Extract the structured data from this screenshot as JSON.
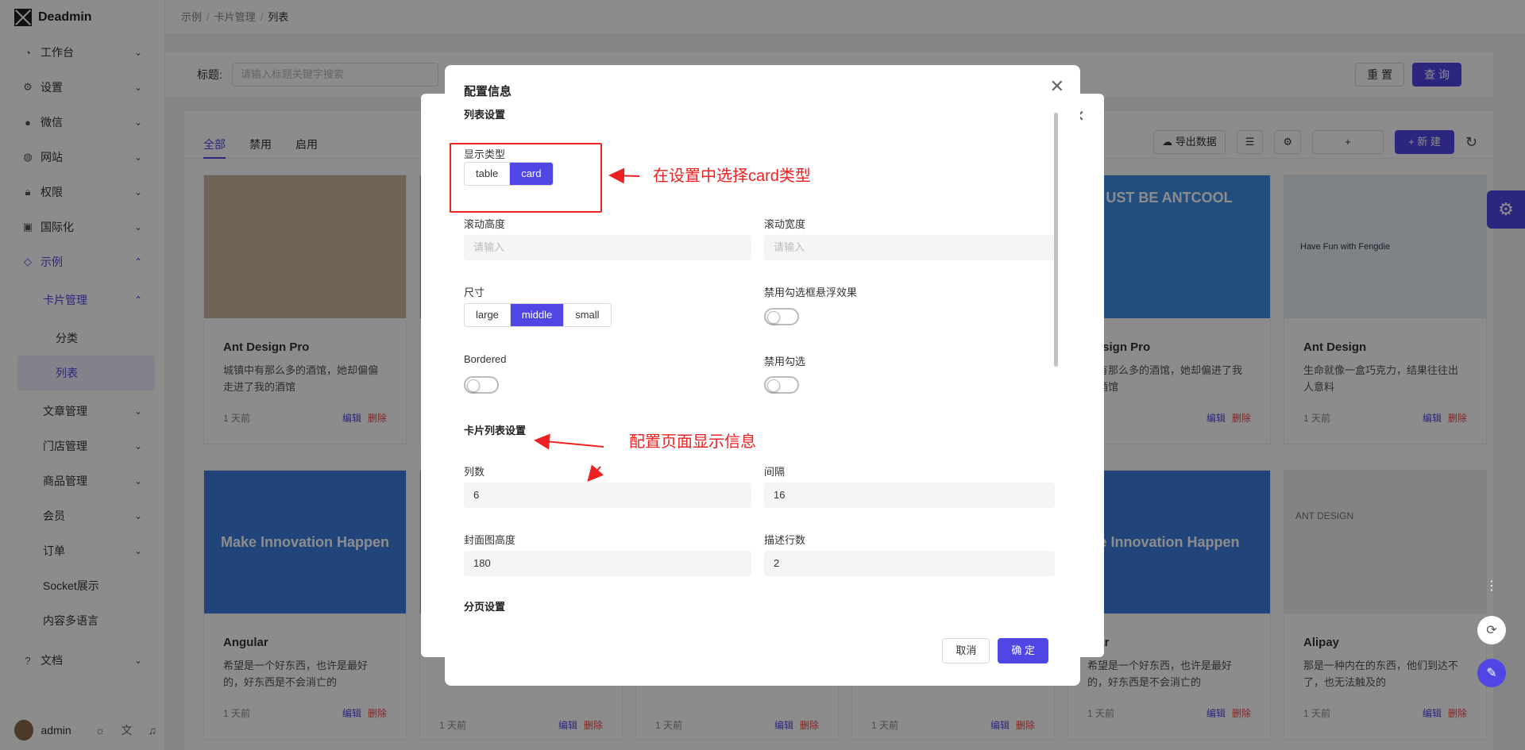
{
  "app": {
    "name": "Deadmin"
  },
  "sidebar": {
    "items": [
      {
        "label": "工作台",
        "icon": "dashboard-icon"
      },
      {
        "label": "设置",
        "icon": "gear-icon"
      },
      {
        "label": "微信",
        "icon": "wechat-icon"
      },
      {
        "label": "网站",
        "icon": "globe-icon"
      },
      {
        "label": "权限",
        "icon": "lock-icon"
      },
      {
        "label": "国际化",
        "icon": "translate-icon"
      },
      {
        "label": "示例",
        "icon": "tag-icon"
      },
      {
        "label": "卡片管理"
      },
      {
        "label": "分类"
      },
      {
        "label": "列表"
      },
      {
        "label": "文章管理"
      },
      {
        "label": "门店管理"
      },
      {
        "label": "商品管理"
      },
      {
        "label": "会员"
      },
      {
        "label": "订单"
      },
      {
        "label": "Socket展示"
      },
      {
        "label": "内容多语言"
      },
      {
        "label": "文档",
        "icon": "question-icon"
      }
    ],
    "user": "admin"
  },
  "breadcrumb": [
    "示例",
    "卡片管理",
    "列表"
  ],
  "search": {
    "label": "标题:",
    "placeholder": "请输入标题关键字搜索",
    "reset": "重 置",
    "query": "查 询"
  },
  "tabs": [
    "全部",
    "禁用",
    "启用"
  ],
  "toolbar": {
    "export": "导出数据",
    "plus": "+",
    "new": "+ 新 建"
  },
  "cards": [
    {
      "title": "Ant Design Pro",
      "desc": "城镇中有那么多的酒馆，她却偏偏走进了我的酒馆",
      "time": "1 天前",
      "cover": ""
    },
    {
      "title": "",
      "desc": "",
      "time": "",
      "cover": ""
    },
    {
      "title": "",
      "desc": "",
      "time": "",
      "cover": ""
    },
    {
      "title": "",
      "desc": "",
      "time": "",
      "cover": ""
    },
    {
      "title": "Design Pro",
      "desc": "中有那么多的酒馆，她却偏进了我的酒馆",
      "time": "",
      "cover": "UST BE ANTCOOL"
    },
    {
      "title": "Ant Design",
      "desc": "生命就像一盒巧克力，结果往往出人意料",
      "time": "1 天前",
      "cover": "Have Fun with Fengdie"
    },
    {
      "title": "Angular",
      "desc": "希望是一个好东西，也许是最好的，好东西是不会消亡的",
      "time": "1 天前",
      "cover": "Make Innovation Happen"
    },
    {
      "title": "",
      "desc": "",
      "time": "1 天前",
      "cover": ""
    },
    {
      "title": "",
      "desc": "",
      "time": "1 天前",
      "cover": ""
    },
    {
      "title": "",
      "desc": "",
      "time": "1 天前",
      "cover": ""
    },
    {
      "title": "ular",
      "desc": "希望是一个好东西，也许是最好的，好东西是不会消亡的",
      "time": "1 天前",
      "cover": "e Innovation Happen"
    },
    {
      "title": "Alipay",
      "desc": "那是一种内在的东西，他们到达不了，也无法触及的",
      "time": "1 天前",
      "cover": "ANT DESIGN"
    }
  ],
  "card_actions": {
    "edit": "编辑",
    "delete": "删除"
  },
  "modal": {
    "title": "配置信息",
    "section_list": "列表设置",
    "display_type_label": "显示类型",
    "display_type_options": [
      "table",
      "card"
    ],
    "display_type_selected": "card",
    "scroll_height_label": "滚动高度",
    "scroll_height_placeholder": "请输入",
    "scroll_width_label": "滚动宽度",
    "scroll_width_placeholder": "请输入",
    "size_label": "尺寸",
    "size_options": [
      "large",
      "middle",
      "small"
    ],
    "size_selected": "middle",
    "disable_hover_label": "禁用勾选框悬浮效果",
    "bordered_label": "Bordered",
    "disable_check_label": "禁用勾选",
    "section_card": "卡片列表设置",
    "columns_label": "列数",
    "columns_value": "6",
    "gap_label": "间隔",
    "gap_value": "16",
    "cover_height_label": "封面图高度",
    "cover_height_value": "180",
    "desc_rows_label": "描述行数",
    "desc_rows_value": "2",
    "section_pagination": "分页设置",
    "cancel": "取消",
    "ok": "确 定"
  },
  "annotations": {
    "a1": "在设置中选择card类型",
    "a2": "配置页面显示信息"
  },
  "colors": {
    "accent": "#5046e5",
    "annotation": "#e22222",
    "danger": "#e54646"
  }
}
